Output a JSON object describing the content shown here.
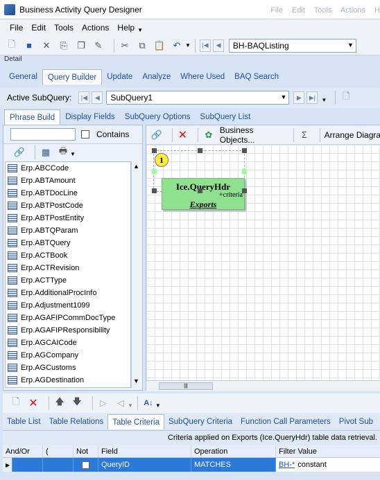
{
  "window": {
    "title": "Business Activity Query Designer",
    "ghost_menu": "File Edit Tools Actions H"
  },
  "menu": [
    "File",
    "Edit",
    "Tools",
    "Actions",
    "Help"
  ],
  "toolbar": {
    "query_combo": "BH-BAQListing"
  },
  "detail_label": "Detail",
  "main_tabs": [
    "General",
    "Query Builder",
    "Update",
    "Analyze",
    "Where Used",
    "BAQ Search"
  ],
  "subquery": {
    "label": "Active SubQuery:",
    "value": "SubQuery1"
  },
  "sub_tabs": [
    "Phrase Build",
    "Display Fields",
    "SubQuery Options",
    "SubQuery List"
  ],
  "left_panel": {
    "contains_label": "Contains",
    "search_value": "",
    "tables": [
      "Erp.ABCCode",
      "Erp.ABTAmount",
      "Erp.ABTDocLine",
      "Erp.ABTPostCode",
      "Erp.ABTPostEntity",
      "Erp.ABTQParam",
      "Erp.ABTQuery",
      "Erp.ACTBook",
      "Erp.ACTRevision",
      "Erp.ACTType",
      "Erp.AdditionalProcInfo",
      "Erp.Adjustment1099",
      "Erp.AGAFIPCommDocType",
      "Erp.AGAFIPResponsibility",
      "Erp.AGCAICode",
      "Erp.AGCompany",
      "Erp.AGCustoms",
      "Erp.AGDestination"
    ]
  },
  "canvas": {
    "business_objects": "Business Objects...",
    "arrange": "Arrange Diagra",
    "node": {
      "number": "1",
      "title": "Ice.QueryHdr",
      "sub": "+criteria",
      "alias": "Exports"
    }
  },
  "bottom_tabs": [
    "Table List",
    "Table Relations",
    "Table Criteria",
    "SubQuery Criteria",
    "Function Call Parameters",
    "Pivot Sub"
  ],
  "criteria_text": "Criteria applied on Exports (Ice.QueryHdr) table data retrieval.",
  "grid": {
    "headers": [
      "And/Or",
      "(",
      "Not",
      "Field",
      "Operation",
      "Filter Value"
    ],
    "row": {
      "field": "QueryID",
      "operation": "MATCHES",
      "filter_link": "BH-*",
      "filter_type": "constant"
    }
  }
}
